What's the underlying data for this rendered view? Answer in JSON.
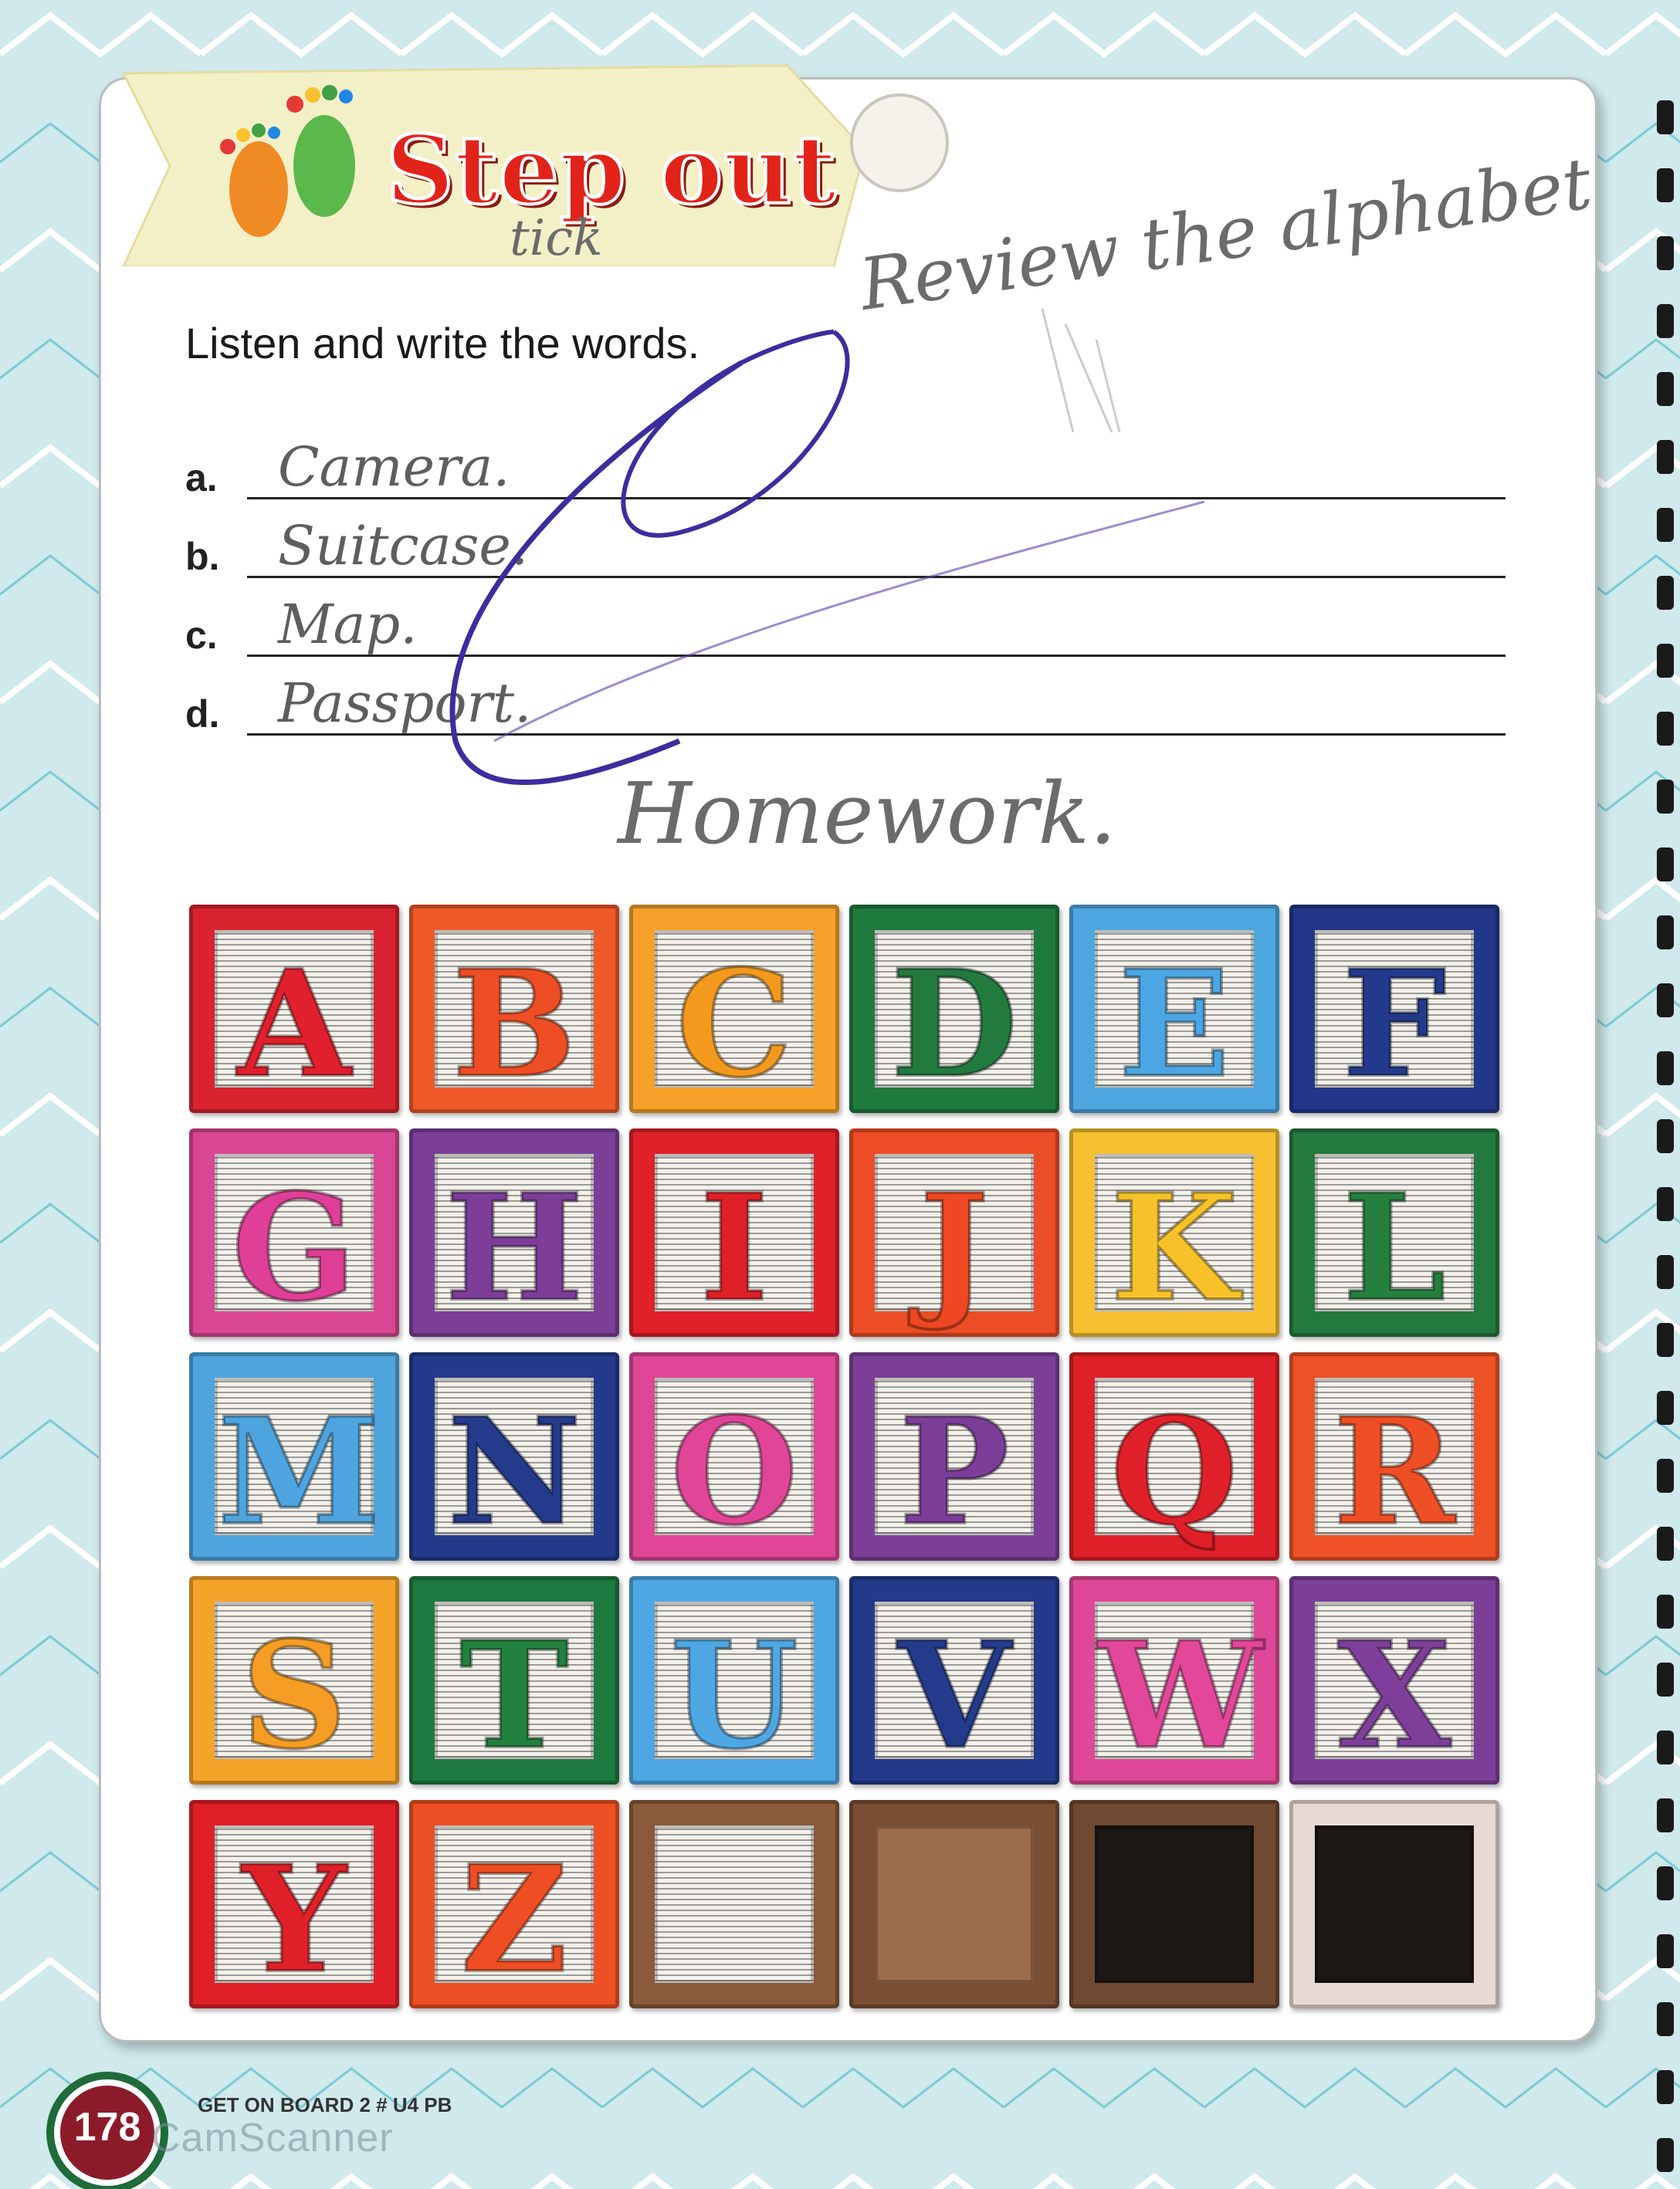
{
  "header": {
    "title": "Step out"
  },
  "exercise": {
    "instruction": "Listen and write the words.",
    "items": [
      {
        "label": "a.",
        "answer": "Camera."
      },
      {
        "label": "b.",
        "answer": "Suitcase."
      },
      {
        "label": "c.",
        "answer": "Map."
      },
      {
        "label": "d.",
        "answer": "Passport."
      }
    ]
  },
  "handwritten_notes": {
    "top_right": "Review the alphabet",
    "top_small": "tick",
    "homework": "Homework."
  },
  "alphabet_blocks": [
    {
      "letter": "A",
      "frame": "#d9232f",
      "letter_color": "#e0202c"
    },
    {
      "letter": "B",
      "frame": "#ef5a2a",
      "letter_color": "#ee4e24"
    },
    {
      "letter": "C",
      "frame": "#f5a12a",
      "letter_color": "#f39a1e"
    },
    {
      "letter": "D",
      "frame": "#1f7a3e",
      "letter_color": "#237a3f"
    },
    {
      "letter": "E",
      "frame": "#4ea6e0",
      "letter_color": "#4ba6e3"
    },
    {
      "letter": "F",
      "frame": "#23378a",
      "letter_color": "#233a8c"
    },
    {
      "letter": "G",
      "frame": "#d94694",
      "letter_color": "#df3f96"
    },
    {
      "letter": "H",
      "frame": "#7b3f98",
      "letter_color": "#7d3d99"
    },
    {
      "letter": "I",
      "frame": "#e02129",
      "letter_color": "#df2027"
    },
    {
      "letter": "J",
      "frame": "#ec4d26",
      "letter_color": "#ee4723"
    },
    {
      "letter": "K",
      "frame": "#f6c030",
      "letter_color": "#f7c229"
    },
    {
      "letter": "L",
      "frame": "#237a3e",
      "letter_color": "#25803f"
    },
    {
      "letter": "M",
      "frame": "#4ea4dd",
      "letter_color": "#4da4df"
    },
    {
      "letter": "N",
      "frame": "#233a8b",
      "letter_color": "#243a8a"
    },
    {
      "letter": "O",
      "frame": "#df4697",
      "letter_color": "#e04597"
    },
    {
      "letter": "P",
      "frame": "#7c3f98",
      "letter_color": "#7b3d98"
    },
    {
      "letter": "Q",
      "frame": "#e02029",
      "letter_color": "#e02029"
    },
    {
      "letter": "R",
      "frame": "#ee5226",
      "letter_color": "#ef4f24"
    },
    {
      "letter": "S",
      "frame": "#f6a32a",
      "letter_color": "#f59d24"
    },
    {
      "letter": "T",
      "frame": "#1f7a3f",
      "letter_color": "#22813f"
    },
    {
      "letter": "U",
      "frame": "#4ea7e2",
      "letter_color": "#4ea7e2"
    },
    {
      "letter": "V",
      "frame": "#233a8a",
      "letter_color": "#243a8b"
    },
    {
      "letter": "W",
      "frame": "#df4898",
      "letter_color": "#e2479a"
    },
    {
      "letter": "X",
      "frame": "#7b3f98",
      "letter_color": "#7d3f9a"
    },
    {
      "letter": "Y",
      "frame": "#df2028",
      "letter_color": "#e02029"
    },
    {
      "letter": "Z",
      "frame": "#ee5025",
      "letter_color": "#ef4d23"
    },
    {
      "letter": "",
      "frame": "#8a5a3a",
      "letter_color": "",
      "inner": "stripes"
    },
    {
      "letter": "",
      "frame": "#7a4e34",
      "letter_color": "",
      "inner": "#9c6b4c"
    },
    {
      "letter": "",
      "frame": "#6f4a31",
      "letter_color": "",
      "inner": "#1c1614"
    },
    {
      "letter": "",
      "frame": "#e8d9d2",
      "letter_color": "",
      "inner": "#1c1614"
    }
  ],
  "footer": {
    "page_number": "178",
    "book_ref": "GET ON BOARD 2 # U4 PB",
    "watermark": "CamScanner"
  }
}
